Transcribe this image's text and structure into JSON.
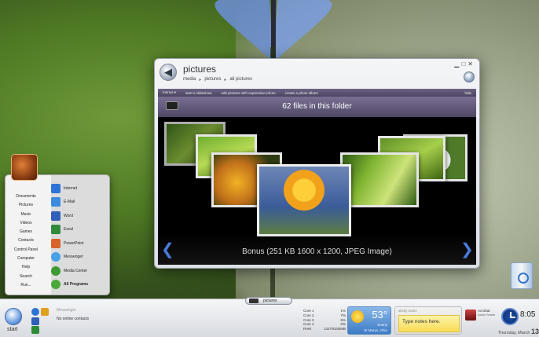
{
  "window": {
    "title": "pictures",
    "breadcrumbs": [
      "media",
      "pictures",
      "all pictures"
    ],
    "toolbar": {
      "menus": "menus ▾",
      "actions": [
        "start a slideshow",
        "edit pictures with expression photo",
        "create a photo album"
      ],
      "hide": "hide"
    },
    "folder_count": "62 files in this folder",
    "caption": "Bonus  (251 KB 1600 x 1200, JPEG Image)"
  },
  "start_menu": {
    "left_items": [
      "Documents",
      "Pictures",
      "Music",
      "Videos",
      "Games",
      "Contacts",
      "Control Panel",
      "Computer",
      "Help",
      "Search",
      "Run..."
    ],
    "right_items": [
      {
        "label": "Internet",
        "color": "#2b73d6"
      },
      {
        "label": "E-Mail",
        "color": "#3b8be0"
      },
      {
        "label": "Word",
        "color": "#2f5fb8"
      },
      {
        "label": "Excel",
        "color": "#2f8a3a"
      },
      {
        "label": "PowerPoint",
        "color": "#d8642a"
      },
      {
        "label": "Messenger",
        "color": "#46a2e8"
      },
      {
        "label": "Media Center",
        "color": "#3e9a32"
      },
      {
        "label": "All Programs",
        "color": "#4aa83a"
      }
    ]
  },
  "taskbar": {
    "start_label": "start",
    "messenger_title": "Messenger",
    "messenger_sub": "No online contacts",
    "active_task": "pictures",
    "cpu": [
      {
        "label": "Core 1",
        "value": "1%"
      },
      {
        "label": "Core 2",
        "value": "7%"
      },
      {
        "label": "Core 3",
        "value": "5%"
      },
      {
        "label": "Core 4",
        "value": "0%"
      },
      {
        "label": "RAM",
        "value": "1427/8192MB"
      }
    ],
    "weather": {
      "temp": "53°",
      "condition": "Sunny",
      "location": "St Marys, Ohio"
    },
    "notes": {
      "title": "sticky notes",
      "body": "Type notes here."
    },
    "app": {
      "name": "Acrobat",
      "sub": "Adobe Reader"
    },
    "clock": {
      "time": "8:05",
      "date_prefix": "Thursday, March",
      "date_day": "13"
    }
  }
}
